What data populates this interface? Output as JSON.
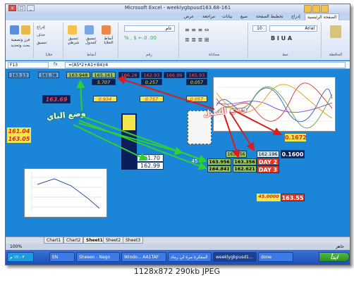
{
  "window": {
    "title": "Microsoft Excel - weeklygbpusd163.68-161",
    "controls": {
      "minimize": "_",
      "maximize": "□",
      "close": "x"
    }
  },
  "ribbon_tabs": [
    "عرض",
    "مراجعة",
    "بيانات",
    "صيغ",
    "تخطيط الصفحة",
    "إدراج",
    "الصفحة الرئيسية"
  ],
  "ribbon": {
    "font_name": "Arial",
    "font_size": "10",
    "number_format": "عام",
    "buttons": [
      "تنسيق شرطي",
      "تنسيق كجدول",
      "أنماط الخلايا",
      "إدراج",
      "حذف",
      "تنسيق",
      "فرز وتصفية",
      "بحث وتحديد"
    ],
    "groups": [
      "خلايا",
      "أنماط",
      "رقم",
      "محاذاة",
      "خط",
      "الحافظة"
    ]
  },
  "formula_bar": {
    "name_box": "F13",
    "fx": "fx",
    "formula": "=(A5*2+A1+B4)/4"
  },
  "sheet": {
    "top_row": [
      "163.13",
      "161.38",
      "163.948",
      "165.161",
      "166.28",
      "162.93",
      "166.99",
      "165.93"
    ],
    "row2": [
      "5.707",
      "0.257",
      "0.057"
    ],
    "left_red": "163.69",
    "row_mid": [
      "0.934",
      "0.757",
      "0.057"
    ],
    "yellow_pair": [
      "161.04",
      "163.05"
    ],
    "center_values": [
      "161.70",
      "162.99"
    ],
    "right_top": "0.1672",
    "block": {
      "r1": [
        "163.956",
        "162.196",
        "0.1600"
      ],
      "r2": [
        "45",
        "163.956",
        "163.356",
        "DAY 2"
      ],
      "r3": [
        "164.841",
        "162.621",
        "DAY 3"
      ]
    },
    "bottom": [
      "45.0000",
      "163.55"
    ],
    "annot_buy": "وضع الباي",
    "annot_sell": "وضع السيل"
  },
  "sheet_tabs": [
    "Chart1",
    "Chart2",
    "Sheet1",
    "Sheet2",
    "Sheet3"
  ],
  "active_sheet": "Sheet1",
  "status": {
    "ready": "جاهز",
    "zoom": "100%"
  },
  "taskbar": {
    "start": "ابدأ",
    "items": [
      "done",
      "weeklygbpusd1...",
      "المفكرة مرة لي رماد",
      "Windo... AA1TAF",
      "Sheeen - Nago",
      "EN"
    ],
    "clock": "١٢:٠٣ م"
  },
  "caption": "1128x872  290kb  JPEG",
  "colors": {
    "sheet_bg": "#1b86d8",
    "yellow": "#f2e64a",
    "red": "#e23a22",
    "navy": "#0b1e5b",
    "green": "#9bc65a",
    "arrow_green": "#2fd12f",
    "arrow_red": "#d81e1e"
  }
}
